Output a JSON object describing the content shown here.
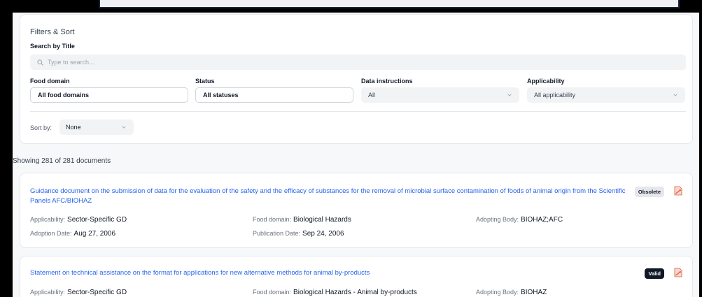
{
  "filters": {
    "title": "Filters & Sort",
    "search_label": "Search by Title",
    "search_placeholder": "Type to search...",
    "food_domain": {
      "label": "Food domain",
      "value": "All food domains"
    },
    "status": {
      "label": "Status",
      "value": "All statuses"
    },
    "data_instructions": {
      "label": "Data instructions",
      "value": "All"
    },
    "applicability": {
      "label": "Applicability",
      "value": "All applicability"
    },
    "sort_label": "Sort by:",
    "sort_value": "None"
  },
  "results": {
    "showing": "Showing 281 of 281 documents"
  },
  "meta_labels": {
    "applicability": "Applicability:",
    "food_domain": "Food domain:",
    "adopting_body": "Adopting Body:",
    "adoption_date": "Adoption Date:",
    "publication_date": "Publication Date:"
  },
  "documents": [
    {
      "title": "Guidance document on the submission of data for the evaluation of the safety and the efficacy of substances for the removal of microbial surface contamination of foods of animal origin from the Scientific Panels AFC/BIOHAZ",
      "status": "Obsolete",
      "applicability": "Sector-Specific GD",
      "food_domain": "Biological Hazards",
      "adopting_body": "BIOHAZ;AFC",
      "adoption_date": "Aug 27, 2006",
      "publication_date": "Sep 24, 2006"
    },
    {
      "title": "Statement on technical assistance on the format for applications for new alternative methods for animal by-products",
      "status": "Valid",
      "applicability": "Sector-Specific GD",
      "food_domain": "Biological Hazards - Animal by-products",
      "adopting_body": "BIOHAZ"
    }
  ],
  "icons": {
    "search": "search-icon",
    "chevron": "chevron-down-icon",
    "pdf": "pdf-file-icon"
  },
  "colors": {
    "link": "#2563eb",
    "valid_badge": "#111827",
    "obsolete_badge": "#e5e7eb",
    "pdf_icon": "#e0573a"
  }
}
